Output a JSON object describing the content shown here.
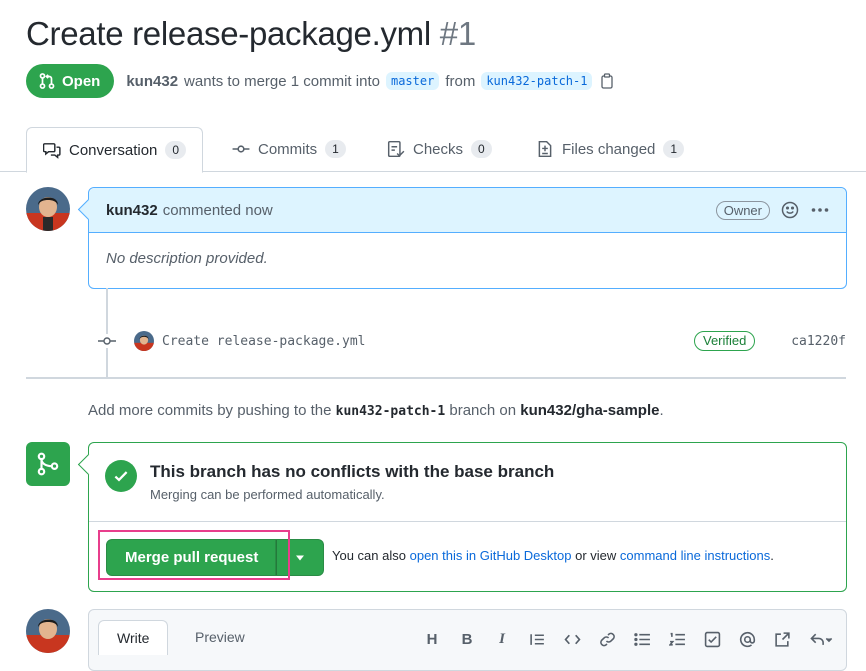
{
  "pr": {
    "title": "Create release-package.yml",
    "number": "#1",
    "state": "Open",
    "author": "kun432",
    "merge_text": "wants to merge 1 commit into",
    "base_branch": "master",
    "from_text": "from",
    "head_branch": "kun432-patch-1"
  },
  "tabs": [
    {
      "label": "Conversation",
      "count": "0"
    },
    {
      "label": "Commits",
      "count": "1"
    },
    {
      "label": "Checks",
      "count": "0"
    },
    {
      "label": "Files changed",
      "count": "1"
    }
  ],
  "comment": {
    "author": "kun432",
    "action": "commented now",
    "badge": "Owner",
    "body": "No description provided."
  },
  "commit": {
    "message": "Create release-package.yml",
    "verified": "Verified",
    "sha": "ca1220f"
  },
  "hint": {
    "prefix": "Add more commits by pushing to the",
    "branch": "kun432-patch-1",
    "middle": "branch on",
    "repo": "kun432/gha-sample",
    "suffix": "."
  },
  "merge": {
    "title": "This branch has no conflicts with the base branch",
    "subtitle": "Merging can be performed automatically.",
    "button": "Merge pull request",
    "note_prefix": "You can also",
    "desktop_link": "open this in GitHub Desktop",
    "note_middle": "or view",
    "cli_link": "command line instructions",
    "note_suffix": "."
  },
  "composer": {
    "write_tab": "Write",
    "preview_tab": "Preview",
    "toolbar": [
      "heading-icon",
      "bold-icon",
      "italic-icon",
      "quote-icon",
      "code-icon",
      "link-icon",
      "unordered-list-icon",
      "ordered-list-icon",
      "task-list-icon",
      "mention-icon",
      "reference-icon",
      "reply-icon"
    ]
  },
  "colors": {
    "open_green": "#2da44e",
    "link_blue": "#0969da",
    "highlight_pink": "#e83e8c",
    "comment_header_bg": "#ddf4ff"
  }
}
